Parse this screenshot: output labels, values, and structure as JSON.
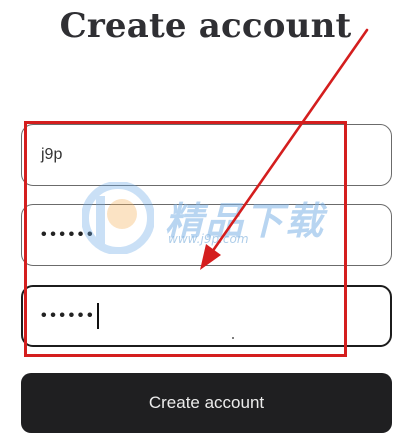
{
  "form": {
    "title": "Create account",
    "username_value": "j9p",
    "password_mask": "••••••",
    "confirm_mask": "••••••",
    "submit_label": "Create account"
  },
  "watermark": {
    "brand_text": "精品下载",
    "url": "www.j9p.com",
    "logo_icon": "j9p-logo-icon"
  },
  "annotation": {
    "color": "#d41e1e",
    "shapes": [
      "highlight-rectangle",
      "pointer-arrow"
    ]
  },
  "colors": {
    "button_bg": "#1f1f21",
    "button_text": "#ececec",
    "focused_border": "#1c1c1c"
  }
}
